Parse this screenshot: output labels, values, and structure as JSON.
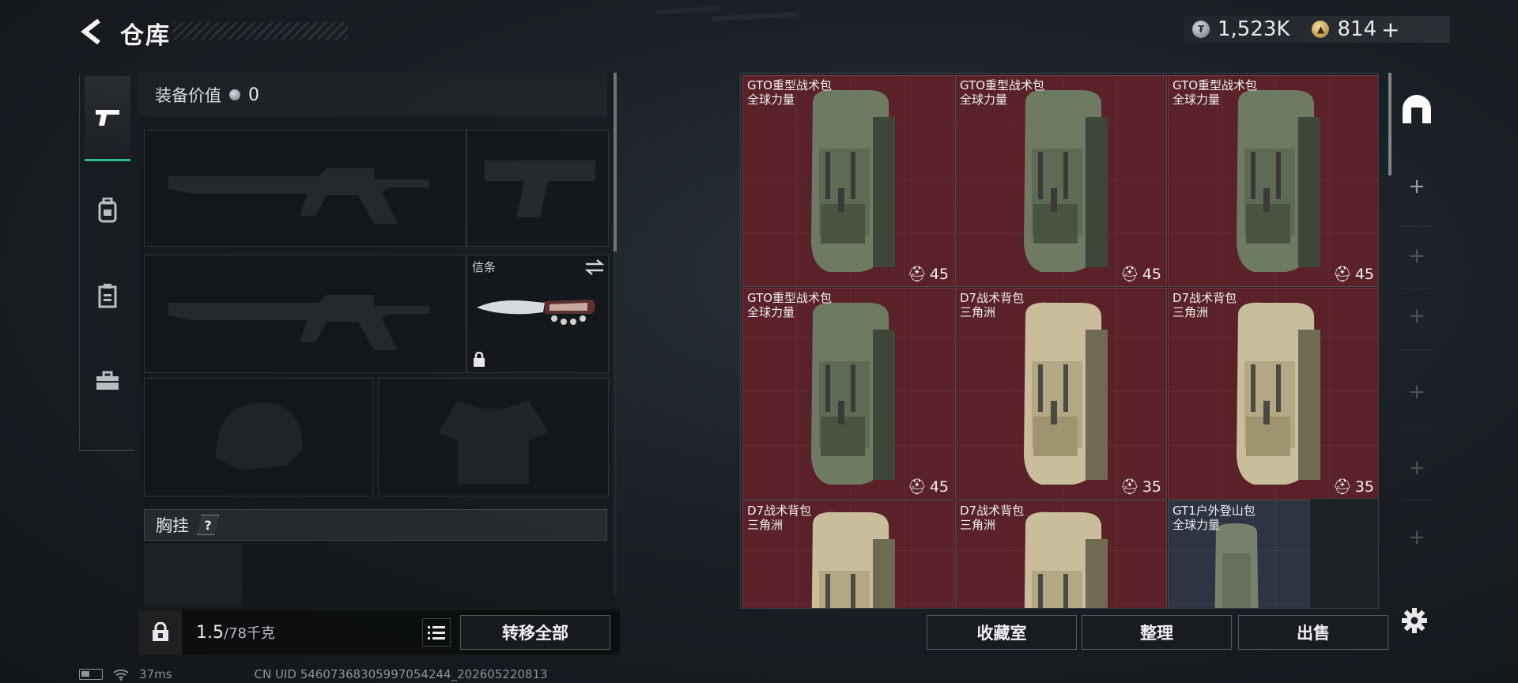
{
  "header": {
    "title": "仓库",
    "currencies": [
      {
        "icon": "silver-coin-icon",
        "value": "1,523K"
      },
      {
        "icon": "gold-coin-icon",
        "value": "814"
      }
    ],
    "add_label": "+"
  },
  "side_tabs": [
    {
      "icon": "pistol-icon",
      "active": true
    },
    {
      "icon": "backpack-icon",
      "active": false
    },
    {
      "icon": "clipboard-icon",
      "active": false
    },
    {
      "icon": "toolbox-icon",
      "active": false
    }
  ],
  "loadout": {
    "equip_value_label": "装备价值",
    "equip_value": "0",
    "melee_slot_label": "信条",
    "chest_rig_label": "胸挂",
    "help_label": "?"
  },
  "weight": {
    "current": "1.5",
    "max": "/78千克"
  },
  "buttons": {
    "transfer_all": "转移全部",
    "collection_room": "收藏室",
    "organize": "整理",
    "sell": "出售"
  },
  "storage": {
    "items": [
      {
        "name": "GTO重型战术包",
        "sub": "全球力量",
        "count": "45",
        "color": "olive"
      },
      {
        "name": "GTO重型战术包",
        "sub": "全球力量",
        "count": "45",
        "color": "olive"
      },
      {
        "name": "GTO重型战术包",
        "sub": "全球力量",
        "count": "45",
        "color": "olive"
      },
      {
        "name": "GTO重型战术包",
        "sub": "全球力量",
        "count": "45",
        "color": "olive"
      },
      {
        "name": "D7战术背包",
        "sub": "三角洲",
        "count": "35",
        "color": "tan"
      },
      {
        "name": "D7战术背包",
        "sub": "三角洲",
        "count": "35",
        "color": "tan"
      },
      {
        "name": "D7战术背包",
        "sub": "三角洲",
        "count": "",
        "color": "tan"
      },
      {
        "name": "D7战术背包",
        "sub": "三角洲",
        "count": "",
        "color": "tan"
      },
      {
        "name": "GT1户外登山包",
        "sub": "全球力量",
        "count": "",
        "color": "olive-small"
      }
    ]
  },
  "status": {
    "ping": "37ms",
    "uid": "CN UID 546073683059970542­44_202605220813"
  }
}
